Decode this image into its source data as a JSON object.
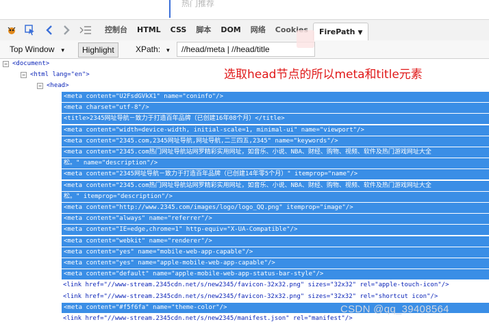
{
  "top": {
    "search_hint": "热门推荐"
  },
  "toolbar": {
    "tabs": [
      "控制台",
      "HTML",
      "CSS",
      "脚本",
      "DOM",
      "网络",
      "Cookies"
    ],
    "active_tab": "FirePath",
    "active_caret": "▼"
  },
  "bar2": {
    "frame_select": "Top Window",
    "frame_caret": "▼",
    "highlight": "Highlight",
    "xpath_label": "XPath:",
    "xpath_caret": "▼",
    "xpath_value": "//head/meta | //head/title"
  },
  "annotation": "选取head节点的所以meta和title元素",
  "tree": {
    "document": "<document>",
    "html_open": "<html lang=\"en\">",
    "head_open": "<head>",
    "lines": [
      {
        "text": "<meta content=\"U2FsdGVkX1\" name=\"coninfo\"/>",
        "hl": true
      },
      {
        "text": "<meta charset=\"utf-8\"/>",
        "hl": true
      },
      {
        "text": "<title>2345网址导航－致力于打造百年品牌（已创建16年08个月）</title>",
        "hl": true
      },
      {
        "text": "<meta content=\"width=device-width, initial-scale=1, minimal-ui\" name=\"viewport\"/>",
        "hl": true
      },
      {
        "text": "<meta content=\"2345.com,2345网址导航,网址导航,二三四五,2345\" name=\"keywords\"/>",
        "hl": true
      },
      {
        "text": "<meta content=\"2345.com热门网址导航站网罗精彩实用网址，如音乐、小说、NBA、财经、购物、视频、软件及热门游戏网址大全",
        "hl": true
      },
      {
        "text": "松。\" name=\"description\"/>",
        "hl": true
      },
      {
        "text": "<meta content=\"2345网址导航－致力于打造百年品牌（已创建14年零5个月）\" itemprop=\"name\"/>",
        "hl": true
      },
      {
        "text": "<meta content=\"2345.com热门网址导航站网罗精彩实用网址，如音乐、小说、NBA、财经、购物、视频、软件及热门游戏网址大全",
        "hl": true
      },
      {
        "text": "松。\" itemprop=\"description\"/>",
        "hl": true
      },
      {
        "text": "<meta content=\"http://www.2345.com/images/logo/logo_QQ.png\" itemprop=\"image\"/>",
        "hl": true
      },
      {
        "text": "<meta content=\"always\" name=\"referrer\"/>",
        "hl": true
      },
      {
        "text": "<meta content=\"IE=edge,chrome=1\" http-equiv=\"X-UA-Compatible\"/>",
        "hl": true
      },
      {
        "text": "<meta content=\"webkit\" name=\"renderer\"/>",
        "hl": true
      },
      {
        "text": "<meta content=\"yes\" name=\"mobile-web-app-capable\"/>",
        "hl": true
      },
      {
        "text": "<meta content=\"yes\" name=\"apple-mobile-web-app-capable\"/>",
        "hl": true
      },
      {
        "text": "<meta content=\"default\" name=\"apple-mobile-web-app-status-bar-style\"/>",
        "hl": true
      },
      {
        "text": "<link href=\"//www-stream.2345cdn.net/s/new2345/favicon-32x32.png\" sizes=\"32x32\" rel=\"apple-touch-icon\"/>",
        "hl": false
      },
      {
        "text": "<link href=\"//www-stream.2345cdn.net/s/new2345/favicon-32x32.png\" sizes=\"32x32\" rel=\"shortcut icon\"/>",
        "hl": false
      },
      {
        "text": "<meta content=\"#f5f6fa\" name=\"theme-color\"/>",
        "hl": true
      },
      {
        "text": "<link href=\"//www-stream.2345cdn.net/s/new2345/manifest.json\" rel=\"manifest\"/>",
        "hl": false
      }
    ]
  },
  "watermark": "CSDN @qq_39408564",
  "colors": {
    "highlight": "#3a8ee6",
    "annotation": "#e01919",
    "tag": "#0b24b8",
    "value": "#b2246c"
  }
}
